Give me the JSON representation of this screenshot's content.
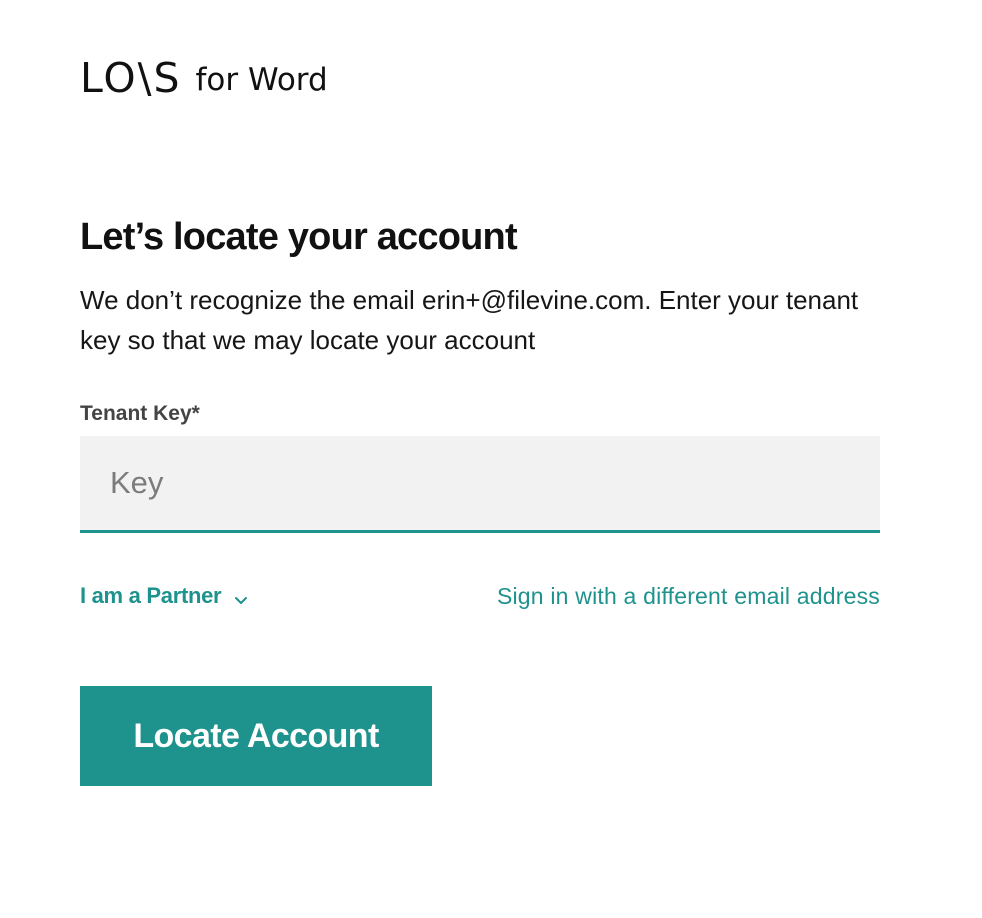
{
  "brand": {
    "logo_text": "LO\\S",
    "product_text": "for Word"
  },
  "page": {
    "title": "Let’s locate your account",
    "description": "We don’t recognize the email erin+@filevine.com. Enter your tenant key so that we may locate your account"
  },
  "form": {
    "tenant_key_label": "Tenant Key*",
    "tenant_key_placeholder": "Key",
    "tenant_key_value": "",
    "partner_toggle_label": "I am a Partner",
    "partner_toggle_icon": "chevron-down-icon",
    "alt_signin_link": "Sign in with a different email address",
    "submit_label": "Locate Account"
  },
  "colors": {
    "accent": "#1e928c",
    "input_background": "#f2f2f2",
    "text": "#161616"
  }
}
